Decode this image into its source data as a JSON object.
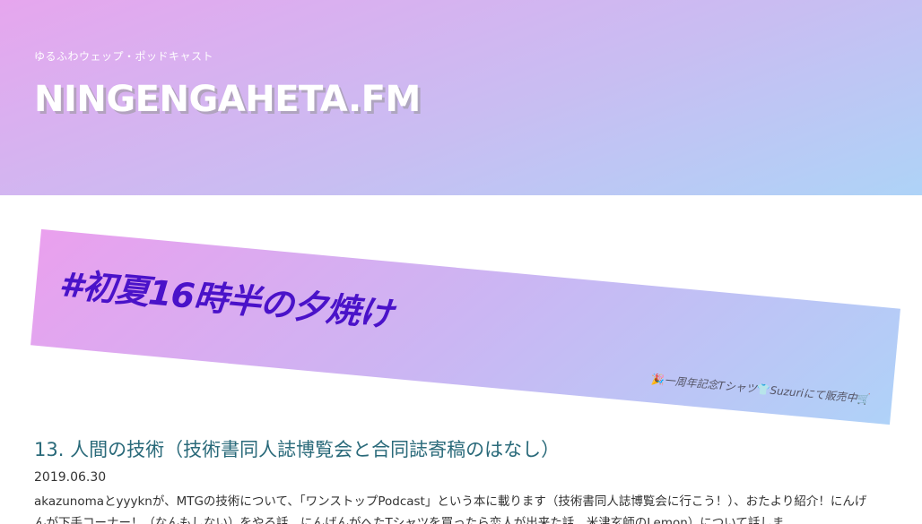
{
  "header": {
    "tagline": "ゆるふわウェップ・ポッドキャスト",
    "site_title": "NINGENGAHETA.FM"
  },
  "banner": {
    "title": "#初夏16時半の夕焼け",
    "promo_text_before": "一周年記念Tシャツ",
    "promo_text_after": "Suzuriにて販売中",
    "promo_icons": [
      "party-popper-icon",
      "tshirt-icon",
      "shopping-cart-icon"
    ]
  },
  "post": {
    "title": "13. 人間の技術（技術書同人誌博覧会と合同誌寄稿のはなし）",
    "date": "2019.06.30",
    "excerpt": "akazunomaとyyyknが、MTGの技術について、「ワンストップPodcast」という本に載ります（技術書同人誌博覧会に行こう！）、おたより紹介！にんげんが下手コーナー！（なんもしない）をやる話、にんげんがへたTシャツを買ったら恋人が出来た話、米津玄師のLemon）について話しま"
  },
  "colors": {
    "header_gradient": [
      "#e6a6ee",
      "#c9bdf2",
      "#aed3f7"
    ],
    "banner_title": "#4a12c9",
    "post_title": "#2a6a7a"
  }
}
